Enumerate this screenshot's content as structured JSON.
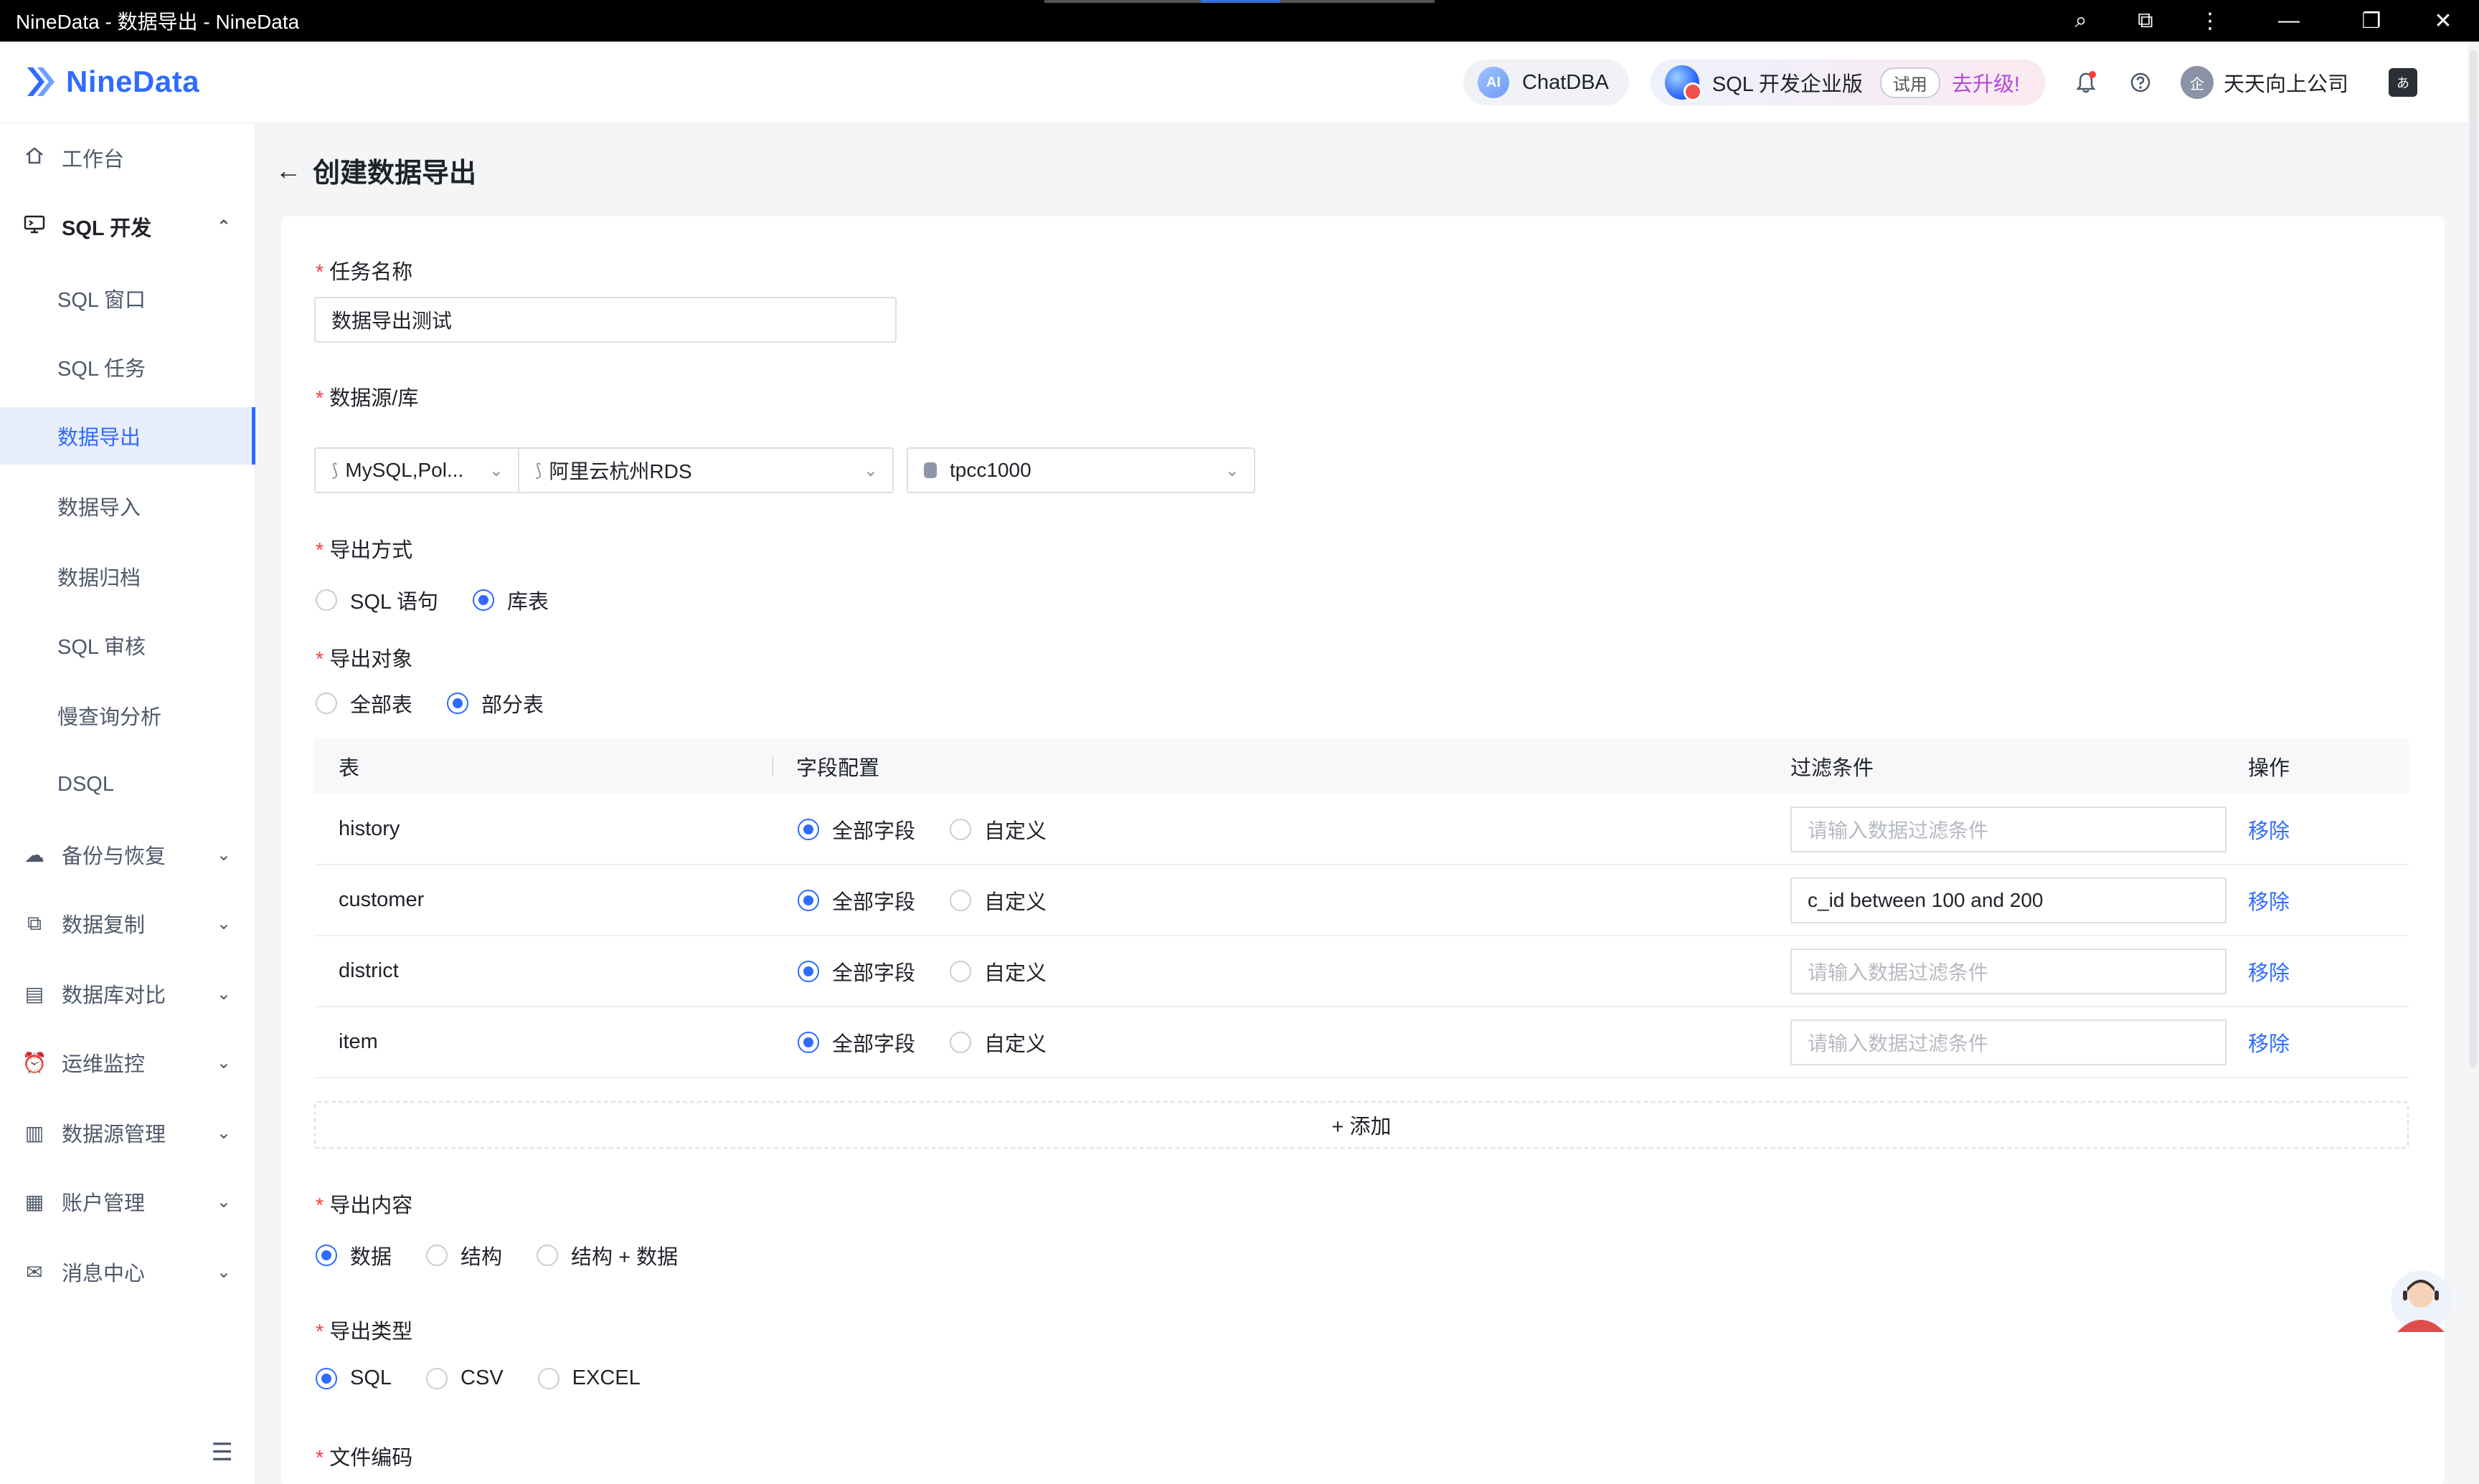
{
  "window": {
    "title": "NineData - 数据导出 - NineData",
    "controls": {
      "search": "⌕",
      "extensions": "⧉",
      "menu": "⋮",
      "minimize": "—",
      "restore": "❐",
      "close": "✕"
    }
  },
  "header": {
    "logo_text": "NineData",
    "chatdba": {
      "badge": "AI",
      "label": "ChatDBA"
    },
    "edition": {
      "label": "SQL 开发企业版",
      "trial": "试用",
      "upgrade": "去升级!"
    },
    "user_avatar": "企",
    "user_name": "天天向上公司",
    "translate_icon": "あ"
  },
  "sidebar": {
    "workbench": "工作台",
    "sql_dev": {
      "label": "SQL 开发",
      "children": [
        "SQL 窗口",
        "SQL 任务",
        "数据导出",
        "数据导入",
        "数据归档",
        "SQL 审核",
        "慢查询分析",
        "DSQL"
      ],
      "active": "数据导出"
    },
    "groups": [
      "备份与恢复",
      "数据复制",
      "数据库对比",
      "运维监控",
      "数据源管理",
      "账户管理",
      "消息中心"
    ]
  },
  "page": {
    "title": "创建数据导出",
    "task_name": {
      "label": "任务名称",
      "value": "数据导出测试"
    },
    "datasource": {
      "label": "数据源/库",
      "type": "MySQL,Pol...",
      "instance": "阿里云杭州RDS",
      "database": "tpcc1000"
    },
    "export_method": {
      "label": "导出方式",
      "options": [
        "SQL 语句",
        "库表"
      ],
      "selected": "库表"
    },
    "export_object": {
      "label": "导出对象",
      "options": [
        "全部表",
        "部分表"
      ],
      "selected": "部分表"
    },
    "table": {
      "headers": {
        "table": "表",
        "fields": "字段配置",
        "filter": "过滤条件",
        "action": "操作"
      },
      "field_options": [
        "全部字段",
        "自定义"
      ],
      "filter_placeholder": "请输入数据过滤条件",
      "action_label": "移除",
      "rows": [
        {
          "name": "history",
          "filter": ""
        },
        {
          "name": "customer",
          "filter": "c_id between 100 and 200"
        },
        {
          "name": "district",
          "filter": ""
        },
        {
          "name": "item",
          "filter": ""
        }
      ],
      "add_label": "+ 添加"
    },
    "export_content": {
      "label": "导出内容",
      "options": [
        "数据",
        "结构",
        "结构 + 数据"
      ],
      "selected": "数据"
    },
    "export_type": {
      "label": "导出类型",
      "options": [
        "SQL",
        "CSV",
        "EXCEL"
      ],
      "selected": "SQL"
    },
    "file_encoding": {
      "label": "文件编码"
    }
  },
  "colors": {
    "primary": "#2f6bff",
    "required": "#f53f3f",
    "upgrade": "#b24ad8"
  }
}
